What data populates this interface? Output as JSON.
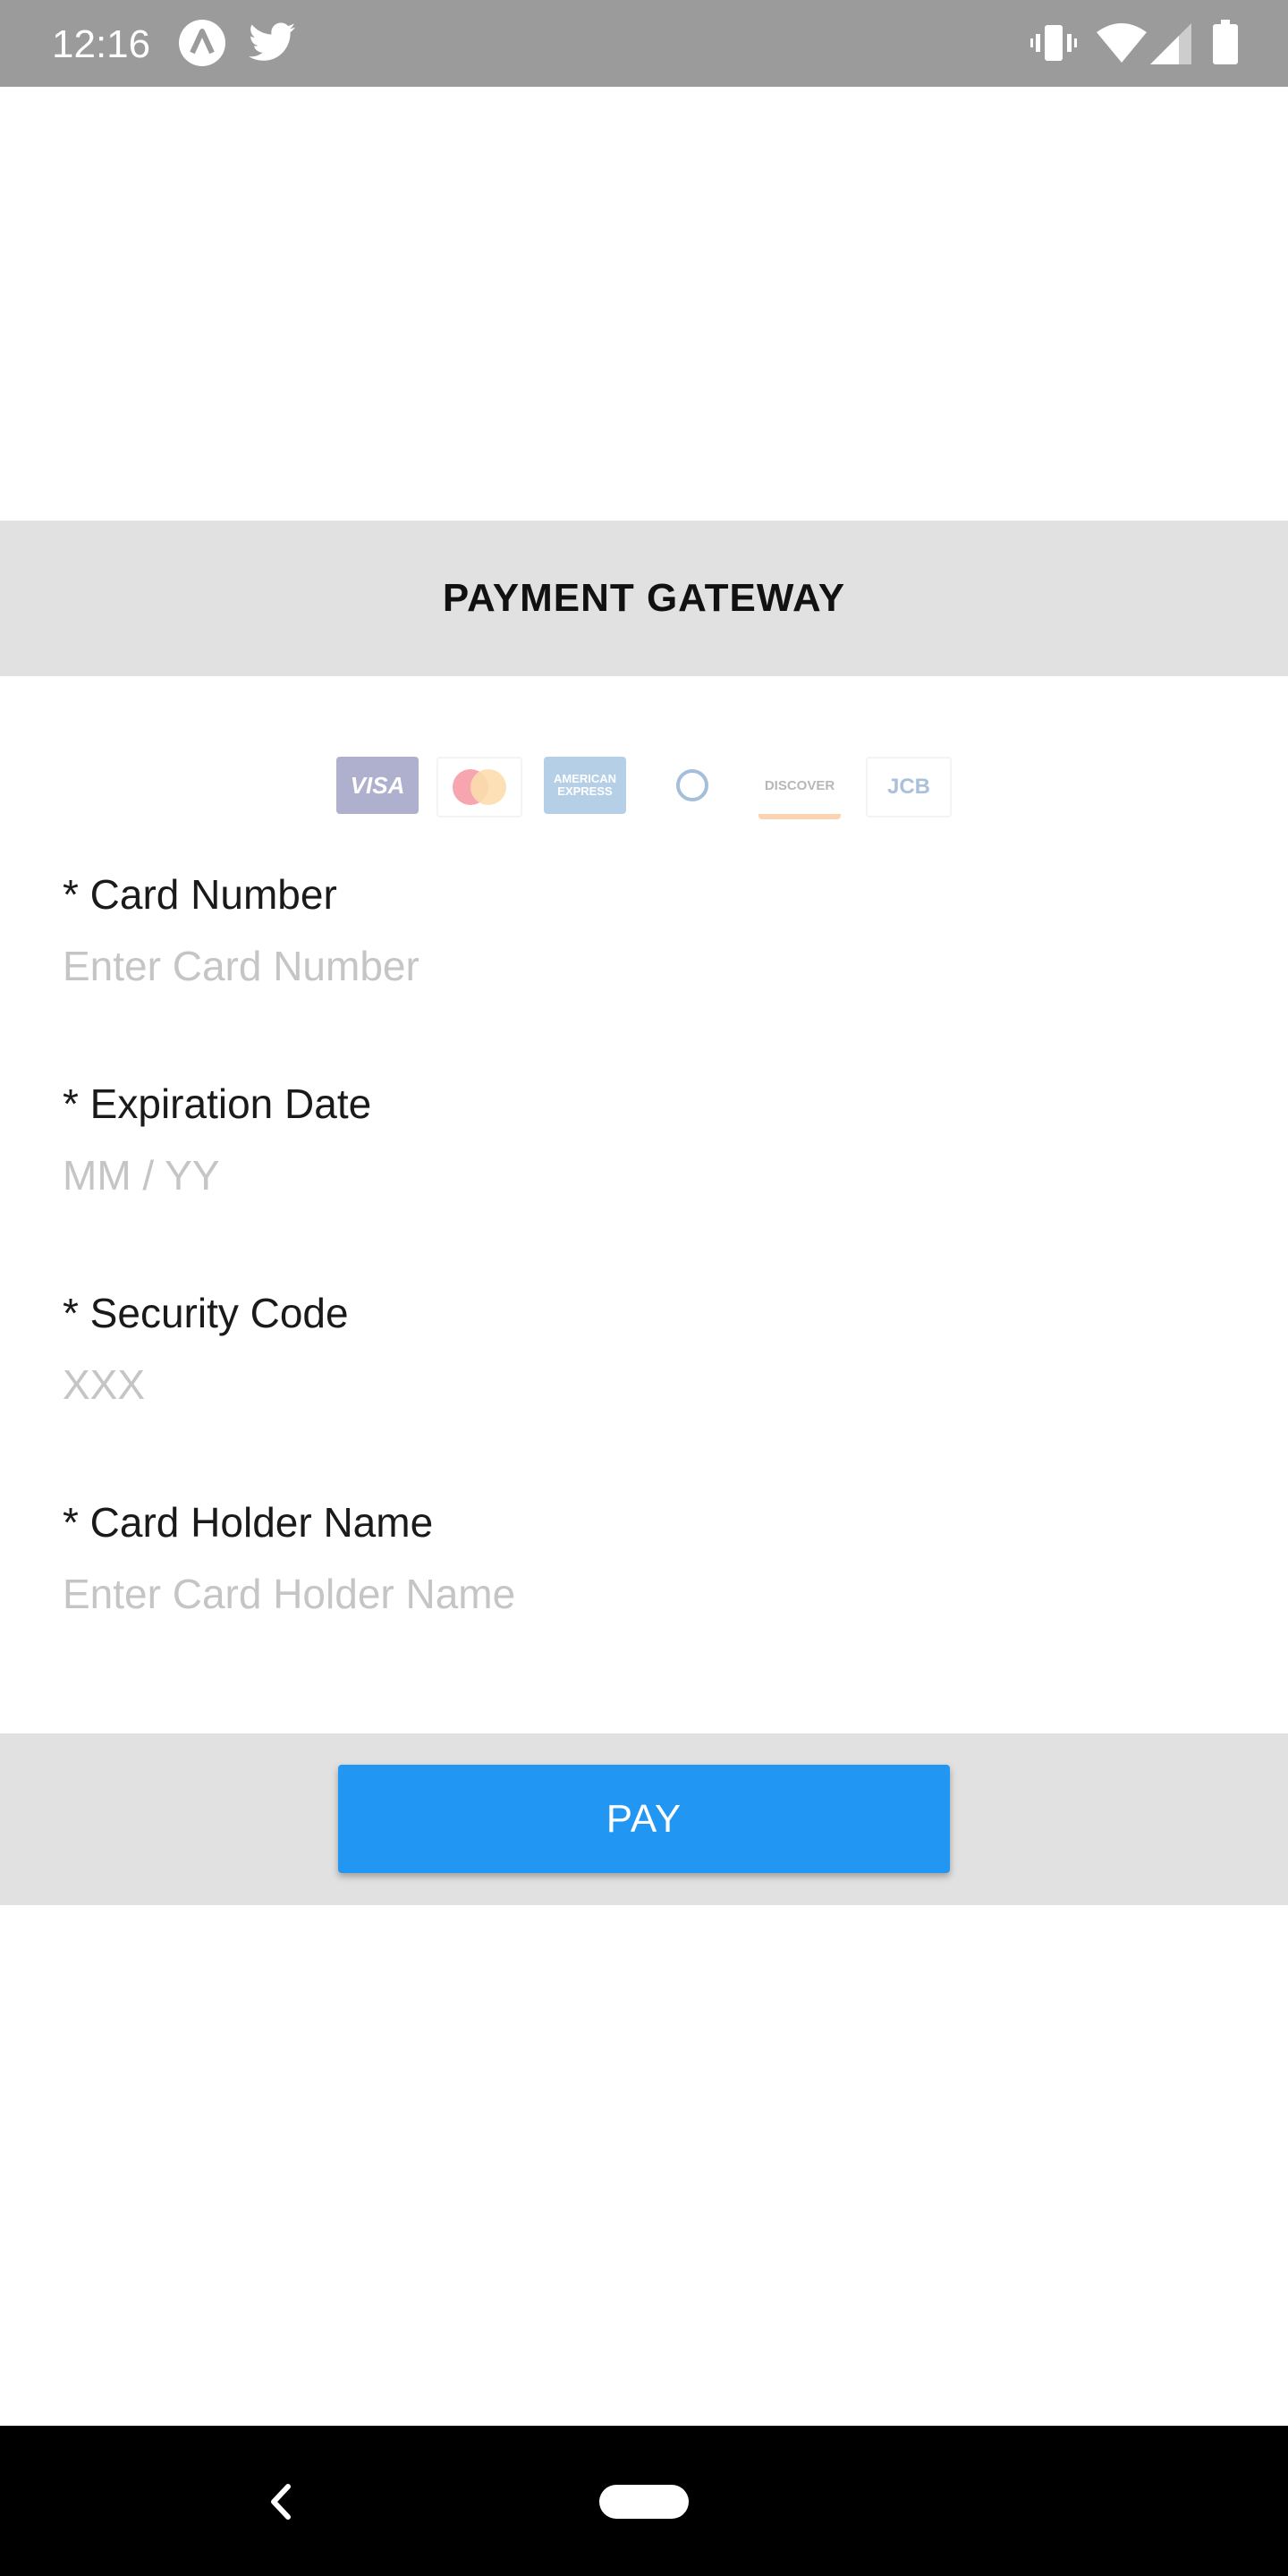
{
  "status_bar": {
    "time": "12:16",
    "icons": [
      "app-a-icon",
      "twitter-icon",
      "vibrate-icon",
      "wifi-icon",
      "signal-icon",
      "battery-icon"
    ]
  },
  "header": {
    "title": "PAYMENT GATEWAY"
  },
  "card_brands": [
    {
      "name": "VISA",
      "color": "#1a1f71"
    },
    {
      "name": "MasterCard",
      "color": "#eb001b"
    },
    {
      "name": "AMERICAN EXPRESS",
      "color": "#2e77bb"
    },
    {
      "name": "Diners Club",
      "color": "#004a97"
    },
    {
      "name": "DISCOVER",
      "color": "#f58220"
    },
    {
      "name": "JCB",
      "color": "#0e4c96"
    }
  ],
  "form": {
    "card_number": {
      "label": "* Card Number",
      "placeholder": "Enter Card Number"
    },
    "expiration": {
      "label": "* Expiration Date",
      "placeholder": "MM / YY"
    },
    "security": {
      "label": "* Security Code",
      "placeholder": "XXX"
    },
    "holder": {
      "label": "* Card Holder Name",
      "placeholder": "Enter Card Holder Name"
    }
  },
  "pay_button": {
    "label": "PAY",
    "color": "#2196f3"
  },
  "navigation": {
    "icons": [
      "back-icon",
      "home-pill-icon"
    ]
  }
}
